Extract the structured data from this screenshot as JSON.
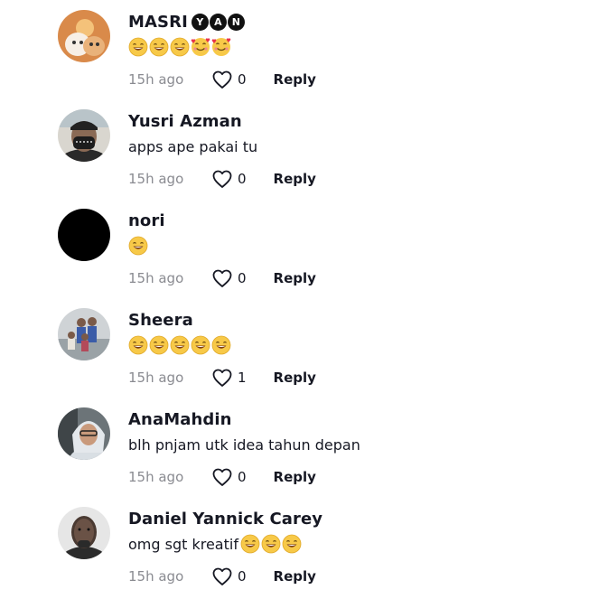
{
  "comments": [
    {
      "name": "MASRI",
      "badges": [
        "Y",
        "A",
        "N"
      ],
      "text": "",
      "emojis": [
        "grin",
        "grin",
        "grin",
        "love",
        "love"
      ],
      "time": "15h ago",
      "likes": "0",
      "reply": "Reply"
    },
    {
      "name": "Yusri Azman",
      "badges": [],
      "text": "apps ape pakai tu",
      "emojis": [],
      "time": "15h ago",
      "likes": "0",
      "reply": "Reply"
    },
    {
      "name": "nori",
      "badges": [],
      "text": "",
      "emojis": [
        "grin"
      ],
      "time": "15h ago",
      "likes": "0",
      "reply": "Reply"
    },
    {
      "name": "Sheera",
      "badges": [],
      "text": "",
      "emojis": [
        "grin",
        "grin",
        "grin",
        "grin",
        "grin"
      ],
      "time": "15h ago",
      "likes": "1",
      "reply": "Reply"
    },
    {
      "name": "AnaMahdin",
      "badges": [],
      "text": "blh pnjam utk idea tahun depan",
      "emojis": [],
      "time": "15h ago",
      "likes": "0",
      "reply": "Reply"
    },
    {
      "name": "Daniel Yannick Carey",
      "badges": [],
      "text": "omg sgt kreatif",
      "emojis": [
        "grin",
        "grin",
        "grin"
      ],
      "time": "15h ago",
      "likes": "0",
      "reply": "Reply"
    }
  ],
  "colors": {
    "text": "#161823",
    "muted": "#8a8b91",
    "emoji_face": "#f7c948"
  },
  "icons": {
    "like": "heart-outline-icon",
    "badge": "letter-circle-badge"
  }
}
